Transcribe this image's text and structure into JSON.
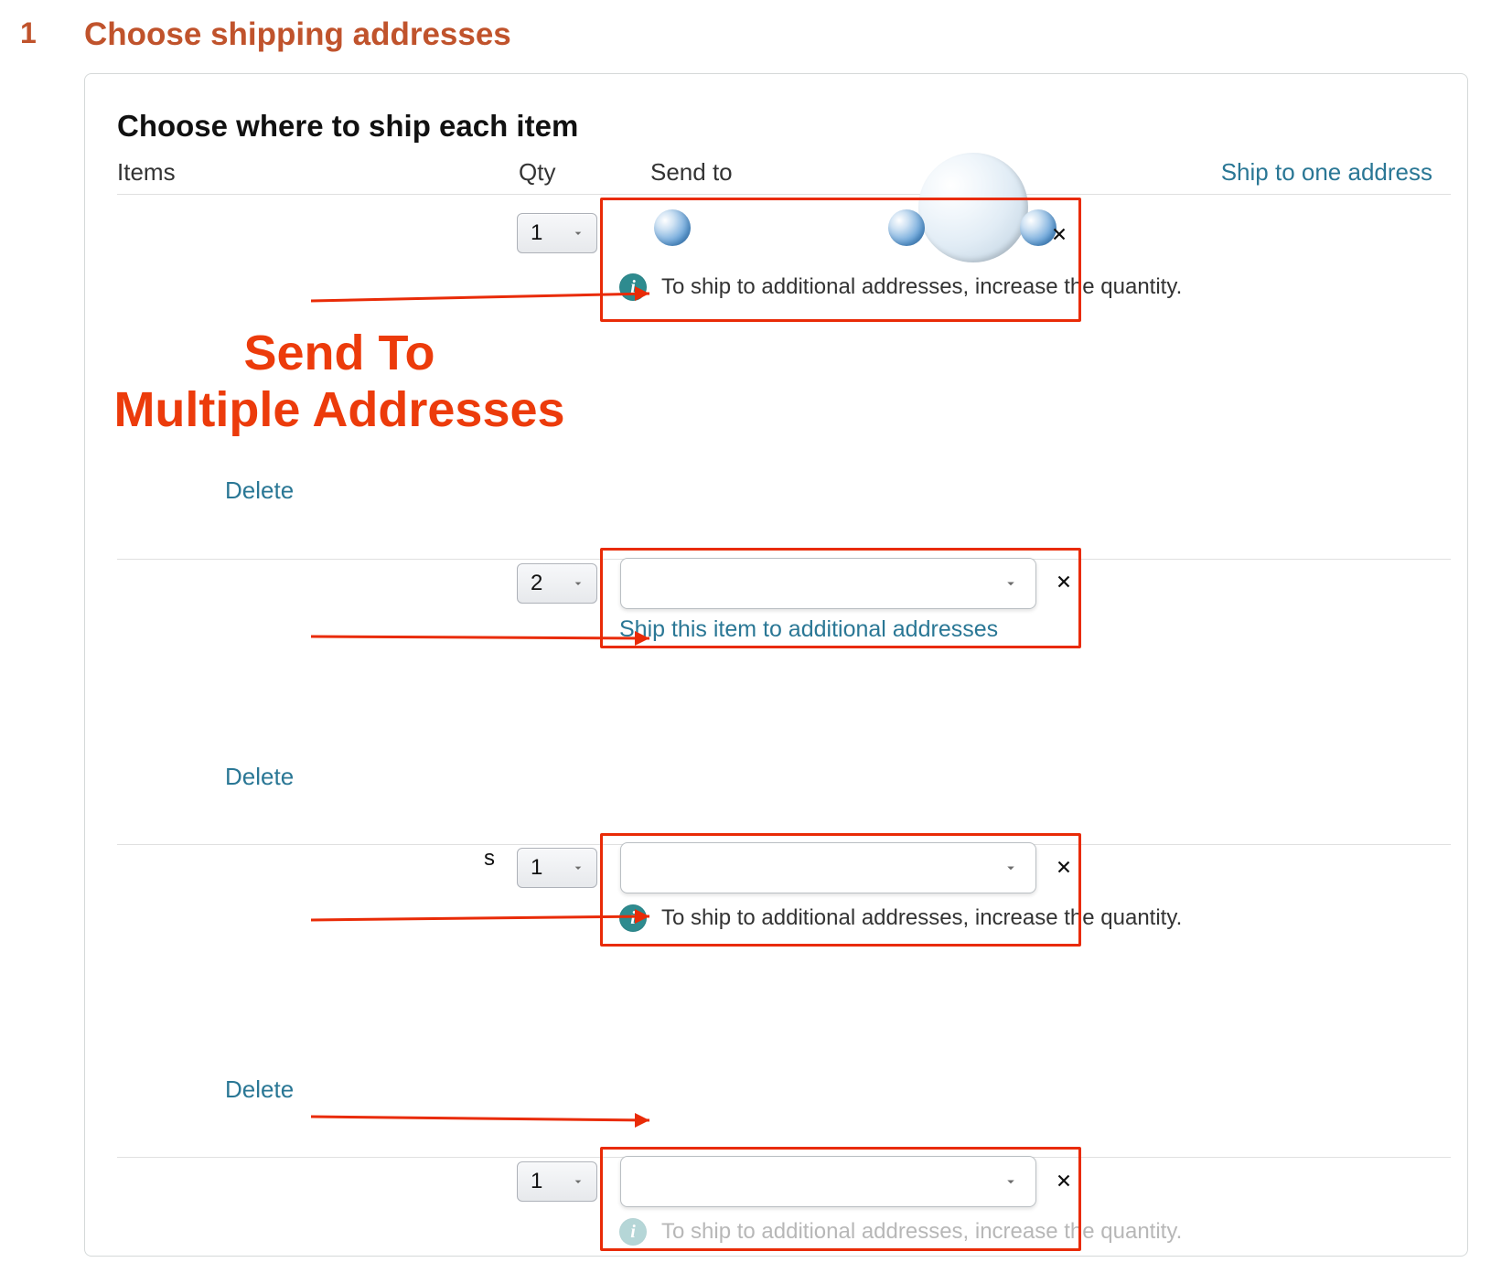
{
  "step": {
    "number": "1",
    "title": "Choose shipping addresses"
  },
  "card_title": "Choose where to ship each item",
  "columns": {
    "items": "Items",
    "qty": "Qty",
    "send_to": "Send to"
  },
  "ship_to_one_link": "Ship to one address",
  "info_qty1": "To ship to additional addresses, increase the quantity.",
  "ship_additional_link": "Ship this item to additional addresses",
  "delete_label": "Delete",
  "rows": [
    {
      "qty": "1"
    },
    {
      "qty": "2"
    },
    {
      "qty": "1"
    },
    {
      "qty": "1"
    }
  ],
  "row3_suffix": "s",
  "annotation": {
    "line1": "Send To",
    "line2": "Multiple Addresses"
  },
  "colors": {
    "orange": "#c0532c",
    "link": "#2a7795",
    "highlight": "#e92b07",
    "annotation": "#ec3b0b"
  }
}
